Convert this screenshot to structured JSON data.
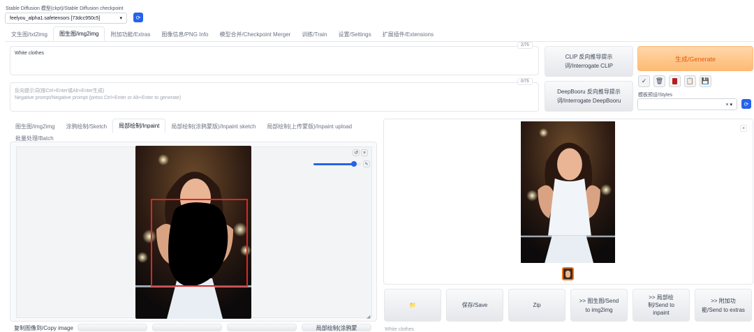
{
  "checkpoint": {
    "label": "Stable Diffusion 模型(ckpt)/Stable Diffusion checkpoint",
    "value": "feelyou_alpha1.safetensors [73dcc950c5]"
  },
  "main_tabs": [
    {
      "label": "文生图/txt2img"
    },
    {
      "label": "图生图/img2img"
    },
    {
      "label": "附加功能/Extras"
    },
    {
      "label": "图像信息/PNG Info"
    },
    {
      "label": "模型合并/Checkpoint Merger"
    },
    {
      "label": "训练/Train"
    },
    {
      "label": "设置/Settings"
    },
    {
      "label": "扩展插件/Extensions"
    }
  ],
  "prompt": {
    "value": "White clothes",
    "count": "2/75"
  },
  "negative": {
    "placeholder_line1": "反向提示词(按Ctrl+Enter或Alt+Enter生成)",
    "placeholder_line2": "Negative prompt/Negative prompt (press Ctrl+Enter or Alt+Enter to generate)",
    "count": "0/75"
  },
  "interrogate": {
    "clip_line1": "CLIP 反向推导提示",
    "clip_line2": "词/Interrogate CLIP",
    "deepbooru_line1": "DeepBooru 反向推导提示",
    "deepbooru_line2": "词/Interrogate DeepBooru"
  },
  "generate": {
    "label": "生成/Generate"
  },
  "styles": {
    "label": "模板预设/Styles",
    "clear": "×",
    "dropdown": "▾"
  },
  "sub_tabs": [
    {
      "label": "图生图/img2img"
    },
    {
      "label": "涂鸦绘制/Sketch"
    },
    {
      "label": "局部绘制/Inpaint"
    },
    {
      "label": "局部绘制(涂鸦蒙版)/Inpaint sketch"
    },
    {
      "label": "局部绘制(上传蒙版)/Inpaint upload"
    },
    {
      "label": "批量处理/Batch"
    }
  ],
  "bottom": {
    "copy_image": "复制图像到/Copy image",
    "inpaint_partial": "局部绘制(涂鸦蒙",
    "output_prompt": "White clothes"
  },
  "output_buttons": [
    {
      "line1": "📁",
      "line2": ""
    },
    {
      "line1": "保存/Save",
      "line2": ""
    },
    {
      "line1": "Zip",
      "line2": ""
    },
    {
      "line1": ">> 图生图/Send",
      "line2": "to img2img"
    },
    {
      "line1": ">> 局部绘",
      "line2": "制/Send to",
      "line3": "inpaint"
    },
    {
      "line1": ">> 附加功",
      "line2": "能/Send to extras"
    }
  ],
  "slider": {
    "fraction": 0.85
  },
  "colors": {
    "accent": "#2563eb",
    "generate_bg": "#fdba74",
    "mask": "#000000",
    "inpaint_box": "#dc2626"
  }
}
